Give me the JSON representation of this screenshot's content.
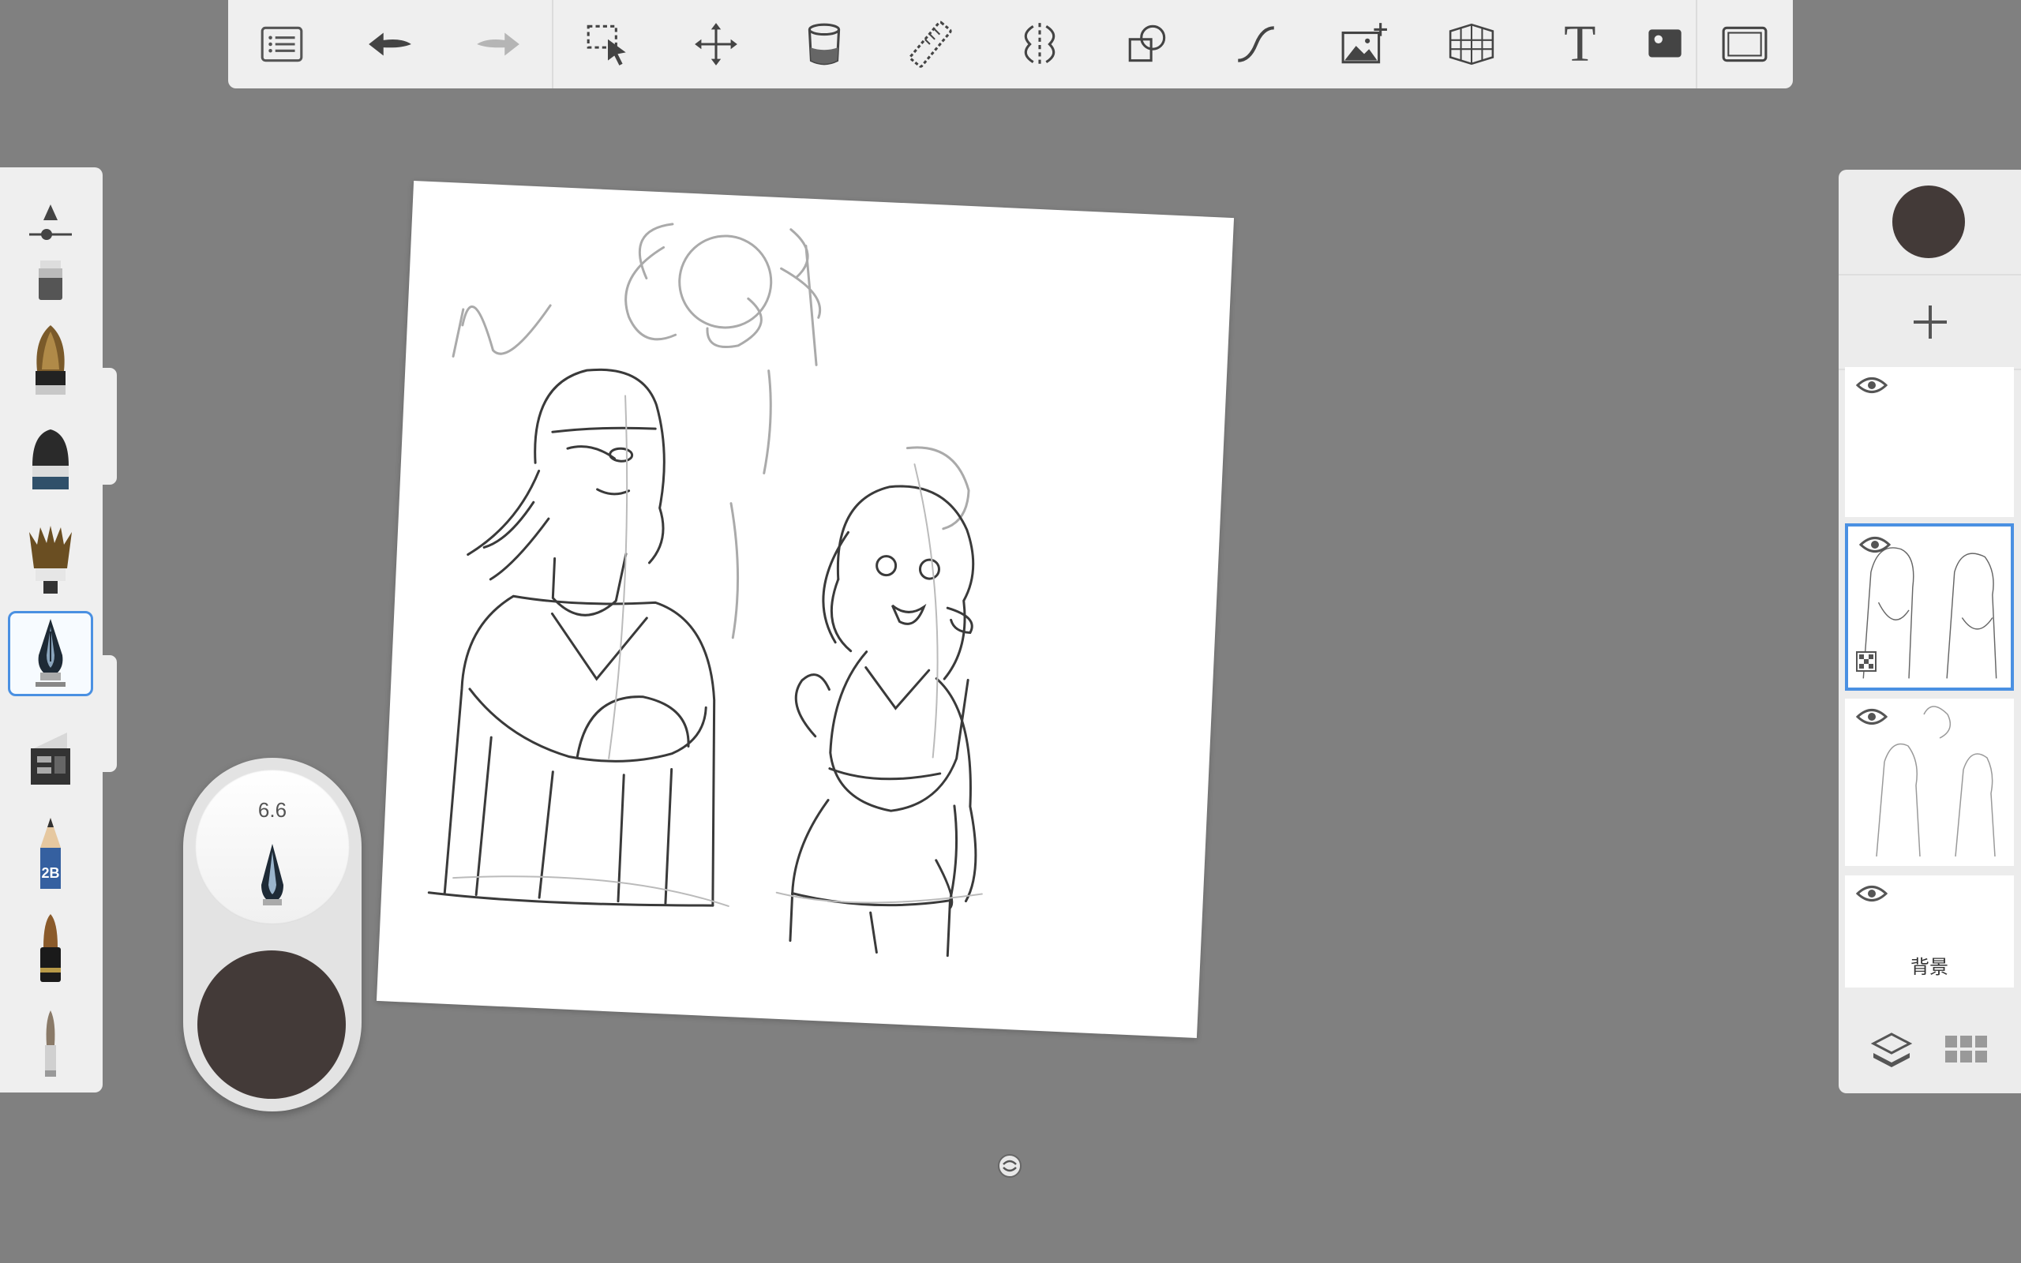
{
  "toolbar": {
    "tools": [
      {
        "name": "brush-library",
        "icon": "list-icon"
      },
      {
        "name": "undo",
        "icon": "undo-arrow-icon"
      },
      {
        "name": "redo",
        "icon": "redo-arrow-icon"
      },
      {
        "name": "selection",
        "icon": "marquee-select-icon"
      },
      {
        "name": "transform",
        "icon": "move-arrows-icon"
      },
      {
        "name": "fill",
        "icon": "paint-bucket-icon"
      },
      {
        "name": "ruler",
        "icon": "ruler-icon"
      },
      {
        "name": "symmetry",
        "icon": "symmetry-icon"
      },
      {
        "name": "shapes",
        "icon": "shapes-icon"
      },
      {
        "name": "stroke",
        "icon": "curve-icon"
      },
      {
        "name": "add-image",
        "icon": "add-image-icon"
      },
      {
        "name": "perspective",
        "icon": "perspective-grid-icon"
      },
      {
        "name": "text",
        "icon": "text-icon"
      },
      {
        "name": "scan",
        "icon": "scan-icon"
      },
      {
        "name": "fullscreen",
        "icon": "fullscreen-icon"
      }
    ],
    "text_tool_label": "T"
  },
  "brush_rail": {
    "items": [
      "opacity-size-slider",
      "marker",
      "brush",
      "round-brush",
      "fan-brush",
      "ink-pen",
      "airbrush",
      "pencil-2b",
      "ink-brush",
      "fine-brush"
    ],
    "selected": "ink-pen",
    "pencil_label": "2B"
  },
  "puck": {
    "size": "6.6",
    "color": "#433a38"
  },
  "layers_panel": {
    "current_color": "#433a38",
    "add_layer_icon": "plus-icon",
    "layers": [
      {
        "visible": true,
        "active": false,
        "name": ""
      },
      {
        "visible": true,
        "active": true,
        "name": ""
      },
      {
        "visible": true,
        "active": false,
        "name": ""
      },
      {
        "visible": true,
        "active": false,
        "name": "背景"
      }
    ]
  },
  "colors": {
    "accent": "#4a90e2",
    "background": "#808080",
    "panel": "#efefef"
  }
}
